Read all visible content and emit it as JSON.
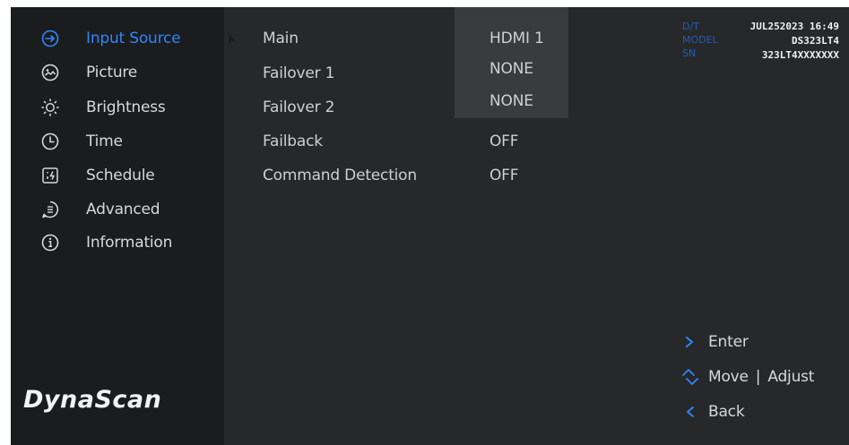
{
  "menu": {
    "items": [
      {
        "label": "Input Source",
        "icon": "input-source-icon",
        "active": true
      },
      {
        "label": "Picture",
        "icon": "picture-icon",
        "active": false
      },
      {
        "label": "Brightness",
        "icon": "brightness-icon",
        "active": false
      },
      {
        "label": "Time",
        "icon": "clock-icon",
        "active": false
      },
      {
        "label": "Schedule",
        "icon": "schedule-icon",
        "active": false
      },
      {
        "label": "Advanced",
        "icon": "advanced-icon",
        "active": false
      },
      {
        "label": "Information",
        "icon": "info-icon",
        "active": false
      }
    ]
  },
  "brand": {
    "logo_text": "DynaScan"
  },
  "settings": {
    "rows": [
      {
        "label": "Main",
        "value": "HDMI 1"
      },
      {
        "label": "Failover 1",
        "value": "NONE"
      },
      {
        "label": "Failover 2",
        "value": "NONE"
      },
      {
        "label": "Failback",
        "value": "OFF"
      },
      {
        "label": "Command Detection",
        "value": "OFF"
      }
    ]
  },
  "device_info": {
    "datetime_label": "D/T",
    "datetime_value": "JUL252023 16:49",
    "model_label": "MODEL",
    "model_value": "DS323LT4",
    "sn_label": "SN",
    "sn_value": "323LT4XXXXXXX"
  },
  "hints": {
    "enter_label": "Enter",
    "move_label": "Move",
    "separator": "|",
    "adjust_label": "Adjust",
    "back_label": "Back"
  },
  "colors": {
    "accent": "#2f86ff",
    "sidebar_bg": "#1b1c1d",
    "main_bg": "#272829",
    "highlight_panel": "#3a3b3c",
    "info_label": "#1e5fc0"
  }
}
